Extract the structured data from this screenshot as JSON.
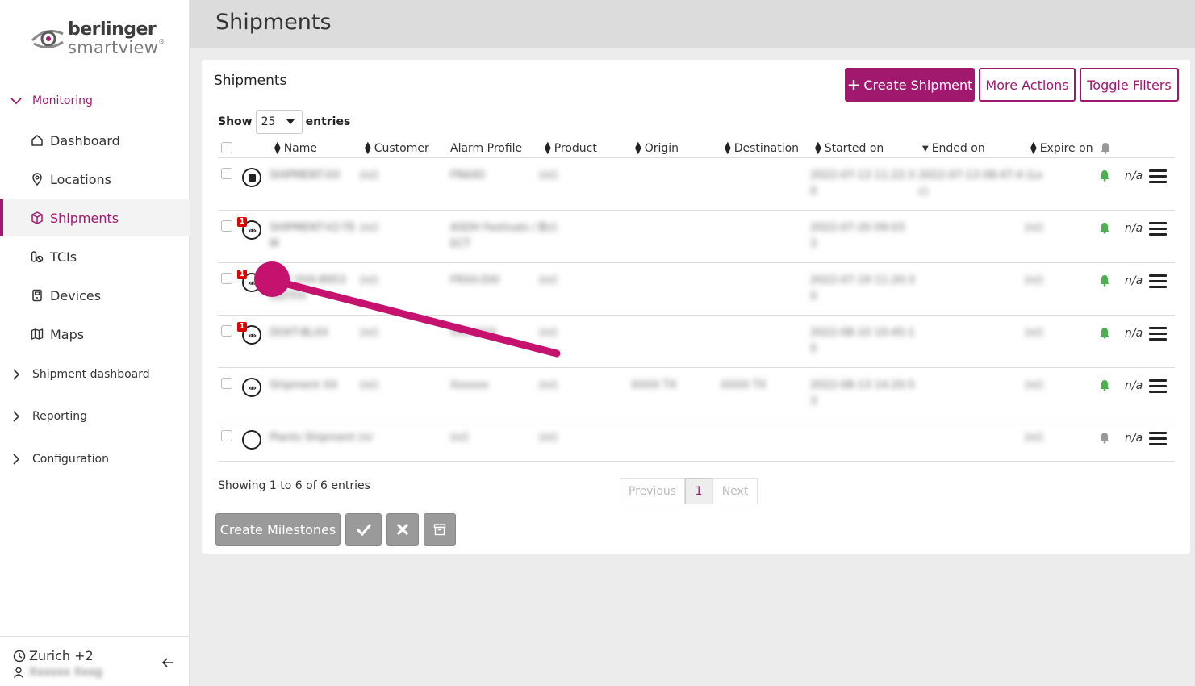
{
  "brand": {
    "name_line1": "berlinger",
    "name_line2": "smartview",
    "accent": "#a0196e"
  },
  "sidebar": {
    "monitoring_label": "Monitoring",
    "items": [
      {
        "label": "Dashboard",
        "icon": "home-icon"
      },
      {
        "label": "Locations",
        "icon": "location-pin-icon"
      },
      {
        "label": "Shipments",
        "icon": "box-icon",
        "active": true
      },
      {
        "label": "TCIs",
        "icon": "tci-icon"
      },
      {
        "label": "Devices",
        "icon": "device-icon"
      },
      {
        "label": "Maps",
        "icon": "map-icon"
      }
    ],
    "groups": [
      {
        "label": "Shipment dashboard"
      },
      {
        "label": "Reporting"
      },
      {
        "label": "Configuration"
      }
    ],
    "footer": {
      "timezone": "Zurich +2",
      "user_name": "Xxxxxx Xxxg"
    }
  },
  "header": {
    "title": "Shipments"
  },
  "card": {
    "title": "Shipments",
    "create_button": "Create Shipment",
    "create_plus": "+",
    "more_actions_button": "More Actions",
    "toggle_filters_button": "Toggle Filters",
    "show_label": "Show",
    "show_value": "25",
    "entries_label": "entries"
  },
  "table": {
    "columns": [
      "Name",
      "Customer",
      "Alarm Profile",
      "Product",
      "Origin",
      "Destination",
      "Started on",
      "Ended on",
      "Expire on"
    ],
    "rows": [
      {
        "status": "stopped",
        "badge": "",
        "name": "SHIPMENT-XX",
        "customer": "(n/)",
        "alarm": "FRAXO",
        "product": "(n/)",
        "origin": "",
        "dest": "",
        "started": "2022-07-13 11:22:3",
        "started2": "0",
        "ended": "2022-07-13 08:47:4 (Lo",
        "ended2": "c)",
        "expire": "",
        "bell_color": "#4caf50",
        "na": "n/a"
      },
      {
        "status": "active",
        "badge": "1",
        "name": "SHIPMENT-V2-TE",
        "name2": "M",
        "customer": "(n/)",
        "alarm": "ASDH Festivals / T",
        "alarm2": "ECT",
        "product": "(n/)",
        "origin": "",
        "dest": "",
        "started": "2022-07-20 09:03",
        "started2": "3",
        "ended": "",
        "expire": "(n/)",
        "bell_color": "#4caf50",
        "na": "n/a"
      },
      {
        "status": "active",
        "badge": "1",
        "name": "ZXX YHX-8953",
        "name2": "DDTFH",
        "customer": "(n/)",
        "alarm": "FRXX-DXI",
        "product": "(n/)",
        "origin": "",
        "dest": "",
        "started": "2022-07-19 11:20:3",
        "started2": "0",
        "ended": "",
        "expire": "(n/)",
        "bell_color": "#4caf50",
        "na": "n/a"
      },
      {
        "status": "active",
        "badge": "1",
        "name": "DOXT-BLXX",
        "customer": "(n/)",
        "alarm": "VXX XXX",
        "product": "(n/)",
        "origin": "",
        "dest": "",
        "started": "2022-08-10 10:45:1",
        "started2": "0",
        "ended": "",
        "expire": "(n/)",
        "bell_color": "#4caf50",
        "na": "n/a"
      },
      {
        "status": "active",
        "badge": "",
        "name": "Shipment XX",
        "customer": "(n/)",
        "alarm": "Xxxxxx",
        "product": "(n/)",
        "origin": "XXXX TX",
        "dest": "XXXX TX",
        "started": "2022-08-13 14:20:5",
        "started2": "3",
        "ended": "",
        "expire": "(n/)",
        "bell_color": "#4caf50",
        "na": "n/a"
      },
      {
        "status": "empty",
        "badge": "",
        "name": "Plants Shipment (n/",
        "customer": "",
        "alarm": "(n/)",
        "product": "(n/)",
        "origin": "",
        "dest": "",
        "started": "",
        "ended": "",
        "expire": "(n/)",
        "bell_color": "#999999",
        "na": "n/a"
      }
    ]
  },
  "footer": {
    "info": "Showing 1 to 6 of 6 entries",
    "prev": "Previous",
    "page": "1",
    "next": "Next",
    "create_milestones": "Create Milestones"
  }
}
